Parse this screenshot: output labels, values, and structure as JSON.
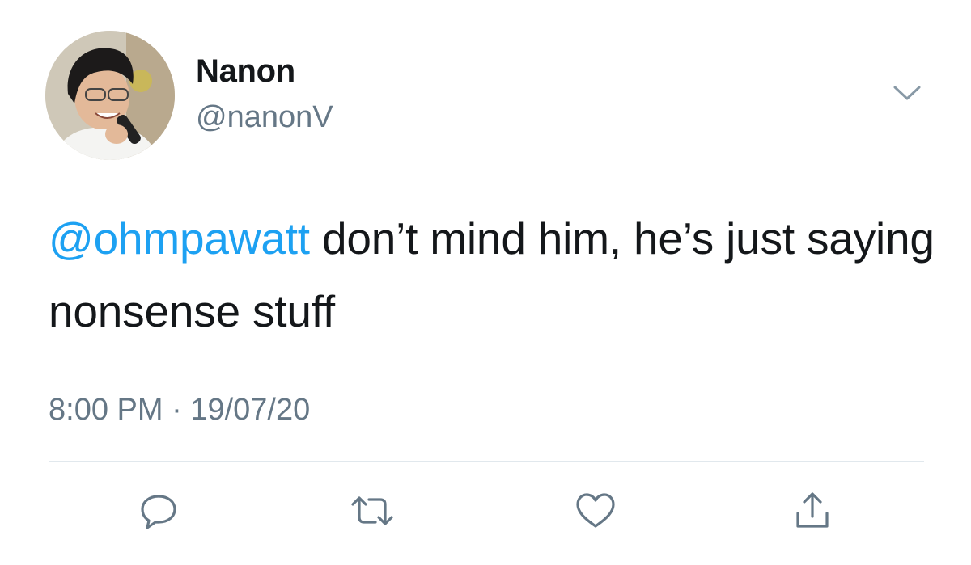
{
  "tweet": {
    "author": {
      "display_name": "Nanon",
      "handle": "@nanonV",
      "avatar_icon": "profile-photo"
    },
    "body": {
      "mention": "@ohmpawatt",
      "text": " don’t mind him, he’s just saying nonsense stuff"
    },
    "meta": {
      "time": "8:00 PM",
      "separator": " · ",
      "date": "19/07/20"
    },
    "menu_icon": "chevron-down-icon",
    "actions": [
      {
        "name": "reply",
        "icon": "speech-bubble-icon"
      },
      {
        "name": "retweet",
        "icon": "retweet-arrows-icon"
      },
      {
        "name": "like",
        "icon": "heart-icon"
      },
      {
        "name": "share",
        "icon": "share-upload-icon"
      }
    ]
  },
  "colors": {
    "accent": "#1da1f2",
    "text_primary": "#14171a",
    "text_secondary": "#657786",
    "divider": "#e1e8ed"
  }
}
